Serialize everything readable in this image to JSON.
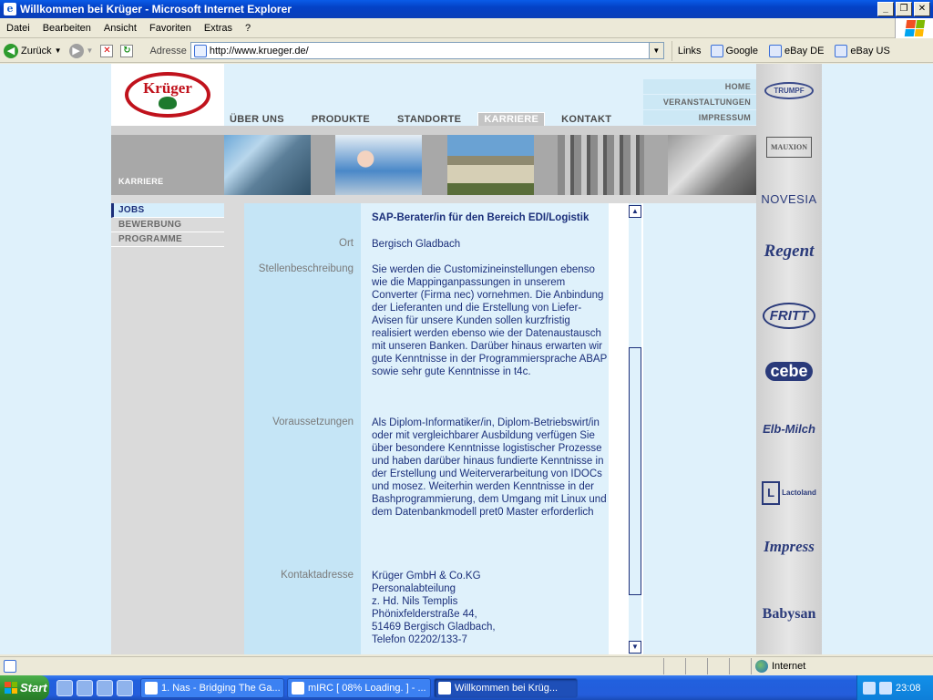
{
  "window": {
    "title": "Willkommen bei Krüger - Microsoft Internet Explorer"
  },
  "menu": [
    "Datei",
    "Bearbeiten",
    "Ansicht",
    "Favoriten",
    "Extras",
    "?"
  ],
  "toolbar": {
    "back_label": "Zurück"
  },
  "address": {
    "label": "Adresse",
    "url": "http://www.krueger.de/"
  },
  "links": {
    "label": "Links",
    "items": [
      "Google",
      "eBay DE",
      "eBay US"
    ]
  },
  "site": {
    "logo_text": "Krüger",
    "main_nav": [
      "ÜBER UNS",
      "PRODUKTE",
      "STANDORTE",
      "KARRIERE",
      "KONTAKT"
    ],
    "active_nav": "KARRIERE",
    "top_right_nav": [
      "HOME",
      "VERANSTALTUNGEN",
      "IMPRESSUM"
    ],
    "section_label": "KARRIERE",
    "left_nav": [
      "JOBS",
      "BEWERBUNG",
      "PROGRAMME"
    ],
    "active_left": "JOBS",
    "job": {
      "title": "SAP-Berater/in für den Bereich EDI/Logistik",
      "labels": {
        "ort": "Ort",
        "beschreibung": "Stellenbeschreibung",
        "voraussetzungen": "Voraussetzungen",
        "kontakt": "Kontaktadresse"
      },
      "ort": "Bergisch Gladbach",
      "beschreibung": "Sie werden die Customizineinstellungen ebenso wie die Mappinganpassungen in unserem Converter (Firma nec) vornehmen. Die Anbindung der Lieferanten und die Erstellung von Liefer-Avisen für unsere Kunden sollen kurzfristig realisiert werden ebenso wie der Datenaustausch mit unseren Banken. Darüber hinaus erwarten wir gute Kenntnisse in der Programmiersprache ABAP sowie sehr gute Kenntnisse in t4c.",
      "voraussetzungen": "Als Diplom-Informatiker/in, Diplom-Betriebswirt/in oder mit vergleichbarer Ausbildung verfügen Sie über besondere Kenntnisse logistischer Prozesse und haben darüber hinaus fundierte Kenntnisse in der Erstellung und Weiterverarbeitung von IDOCs und mosez. Weiterhin werden Kenntnisse in der Bashprogrammierung, dem Umgang mit Linux und dem Datenbankmodell pret0 Master erforderlich",
      "kontakt_lines": [
        "Krüger GmbH & Co.KG",
        "Personalabteilung",
        "z. Hd. Nils Templis",
        "Phönixfelderstraße 44,",
        "51469 Bergisch Gladbach,",
        "Telefon 02202/133-7"
      ]
    },
    "brands": [
      "TRUMPF",
      "MAUXION",
      "NOVESIA",
      "Regent",
      "FRITT",
      "cebe",
      "Elb-Milch",
      "Lactoland",
      "Impress",
      "Babysan"
    ]
  },
  "status": {
    "zone": "Internet"
  },
  "taskbar": {
    "start_label": "Start",
    "tasks": [
      "1. Nas - Bridging The Ga...",
      "mIRC [ 08% Loading. ] - ...",
      "Willkommen bei Krüg..."
    ],
    "active_task_index": 2,
    "clock": "23:08"
  }
}
